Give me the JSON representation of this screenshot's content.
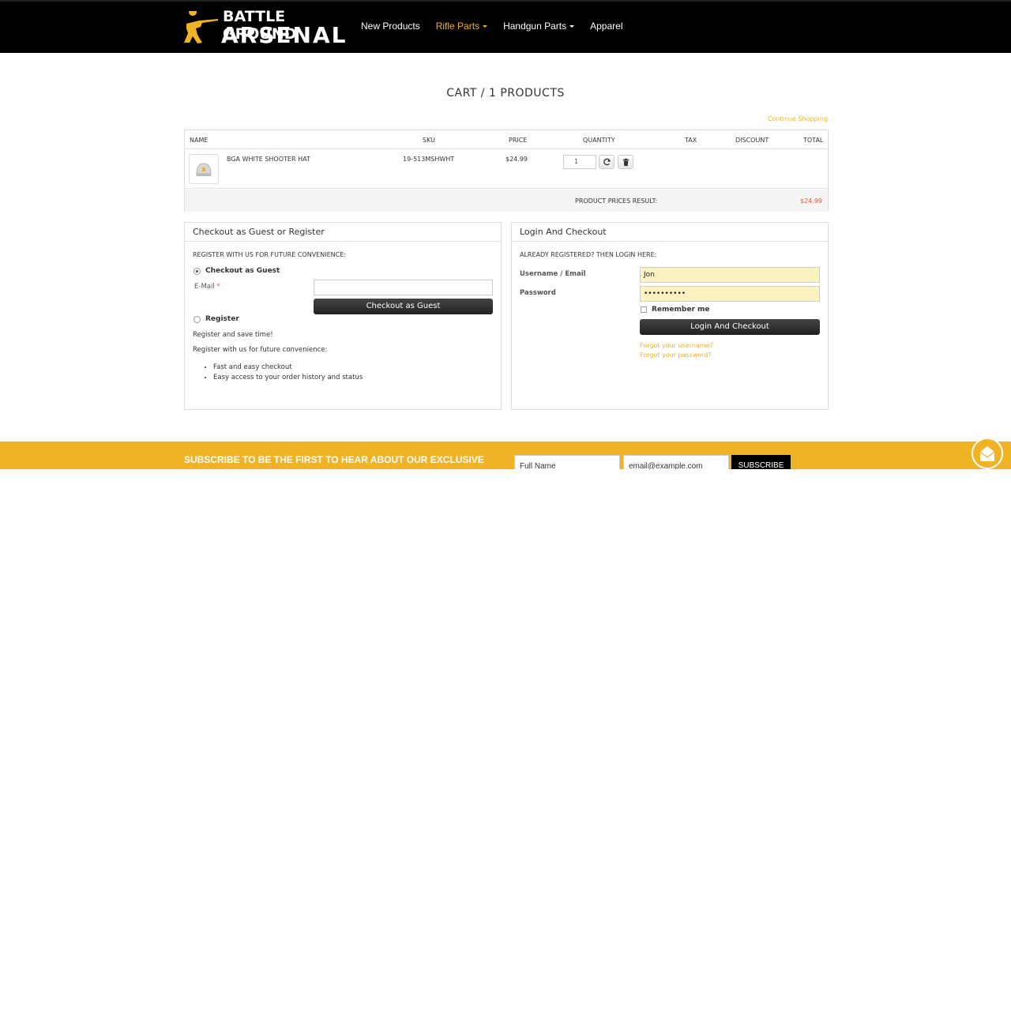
{
  "brand": {
    "line1": "BATTLE GROUND",
    "line2": "ARSENAL",
    "accent_color": "#f0b323"
  },
  "nav": {
    "items": [
      {
        "label": "New Products",
        "active": false,
        "dropdown": false
      },
      {
        "label": "Rifle Parts",
        "active": true,
        "dropdown": true
      },
      {
        "label": "Handgun Parts",
        "active": false,
        "dropdown": true
      },
      {
        "label": "Apparel",
        "active": false,
        "dropdown": false
      }
    ]
  },
  "cart": {
    "title": "CART / 1 PRODUCTS",
    "continue_link": "Continue Shopping",
    "columns": [
      "NAME",
      "SKU",
      "PRICE",
      "QUANTITY",
      "TAX",
      "DISCOUNT",
      "TOTAL"
    ],
    "items": [
      {
        "name": "BGA WHITE SHOOTER HAT",
        "sku": "19-513MSHWHT",
        "price": "$24.99",
        "quantity": "1",
        "icon": "hat-thumbnail"
      }
    ],
    "result_label": "PRODUCT PRICES RESULT:",
    "result_value": "$24.99",
    "result_color": "#e05a3a"
  },
  "guest_panel": {
    "title": "Checkout as Guest or Register",
    "subtitle": "REGISTER WITH US FOR FUTURE CONVENIENCE:",
    "guest_option": "Checkout as Guest",
    "email_label": "E-Mail",
    "required_mark": "*",
    "email_value": "",
    "guest_button": "Checkout as Guest",
    "register_option": "Register",
    "register_line1": "Register and save time!",
    "register_line2": "Register with us for future convenience:",
    "benefits": [
      "Fast and easy checkout",
      "Easy access to your order history and status"
    ]
  },
  "login_panel": {
    "title": "Login And Checkout",
    "subtitle": "ALREADY REGISTERED? THEN LOGIN HERE:",
    "username_label": "Username / Email",
    "username_value": "Jon",
    "password_label": "Password",
    "password_value": "••••••••••",
    "remember_label": "Remember me",
    "login_button": "Login And Checkout",
    "forgot_username": "Forgot your username?",
    "forgot_password": "Forgot your password?"
  },
  "subscribe": {
    "text": "SUBSCRIBE TO BE THE FIRST TO HEAR ABOUT OUR EXCLUSIVE",
    "name_placeholder": "Full Name",
    "email_placeholder": "email@example.com",
    "button": "SUBSCRIBE",
    "band_color": "#f0b323"
  }
}
